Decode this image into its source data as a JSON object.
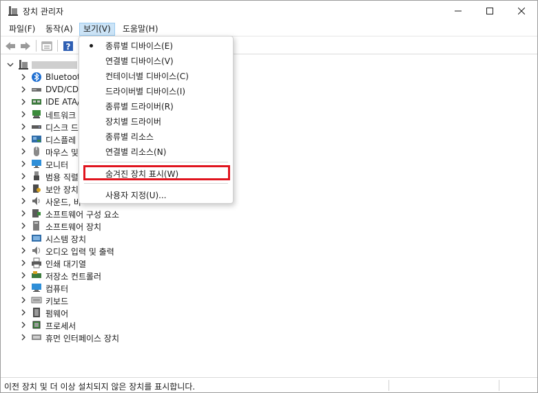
{
  "window": {
    "title": "장치 관리자"
  },
  "menubar": {
    "items": [
      {
        "label": "파일(F)"
      },
      {
        "label": "동작(A)"
      },
      {
        "label": "보기(V)"
      },
      {
        "label": "도움말(H)"
      }
    ]
  },
  "toolbar": {
    "buttons": [
      "back-arrow-icon",
      "forward-arrow-icon",
      "properties-icon",
      "help-icon"
    ]
  },
  "tree": {
    "items": [
      {
        "label": "Bluetooth",
        "icon": "bluetooth-icon"
      },
      {
        "label": "DVD/CD",
        "icon": "dvd-drive-icon"
      },
      {
        "label": "IDE ATA/",
        "icon": "ide-controller-icon"
      },
      {
        "label": "네트워크",
        "icon": "network-adapter-icon"
      },
      {
        "label": "디스크 드",
        "icon": "disk-drive-icon"
      },
      {
        "label": "디스플레",
        "icon": "display-adapter-icon"
      },
      {
        "label": "마우스 및",
        "icon": "mouse-icon"
      },
      {
        "label": "모니터",
        "icon": "monitor-icon"
      },
      {
        "label": "범용 직렬",
        "icon": "usb-icon"
      },
      {
        "label": "보안 장치",
        "icon": "security-device-icon"
      },
      {
        "label": "사운드, 비",
        "icon": "speaker-icon"
      },
      {
        "label": "소프트웨어 구성 요소",
        "icon": "software-component-icon"
      },
      {
        "label": "소프트웨어 장치",
        "icon": "software-device-icon"
      },
      {
        "label": "시스템 장치",
        "icon": "system-device-icon"
      },
      {
        "label": "오디오 입력 및 출력",
        "icon": "audio-io-icon"
      },
      {
        "label": "인쇄 대기열",
        "icon": "printer-icon"
      },
      {
        "label": "저장소 컨트롤러",
        "icon": "storage-controller-icon"
      },
      {
        "label": "컴퓨터",
        "icon": "computer-icon"
      },
      {
        "label": "키보드",
        "icon": "keyboard-icon"
      },
      {
        "label": "펌웨어",
        "icon": "firmware-icon"
      },
      {
        "label": "프로세서",
        "icon": "processor-icon"
      },
      {
        "label": "휴먼 인터페이스 장치",
        "icon": "hid-icon"
      }
    ]
  },
  "view_menu": {
    "items": [
      {
        "label": "종류별 디바이스(E)",
        "checked": true
      },
      {
        "label": "연결별 디바이스(V)"
      },
      {
        "label": "컨테이너별 디바이스(C)"
      },
      {
        "label": "드라이버별 디바이스(I)"
      },
      {
        "label": "종류별 드라이버(R)"
      },
      {
        "label": "장치별 드라이버"
      },
      {
        "label": "종류별 리소스"
      },
      {
        "label": "연결별 리소스(N)"
      }
    ],
    "show_hidden": {
      "label": "숨겨진 장치 표시(W)"
    },
    "customize": {
      "label": "사용자 지정(U)..."
    },
    "highlight_color": "#e0141e"
  },
  "statusbar": {
    "text": "이전 장치 및 더 이상 설치되지 않은 장치를 표시합니다."
  }
}
